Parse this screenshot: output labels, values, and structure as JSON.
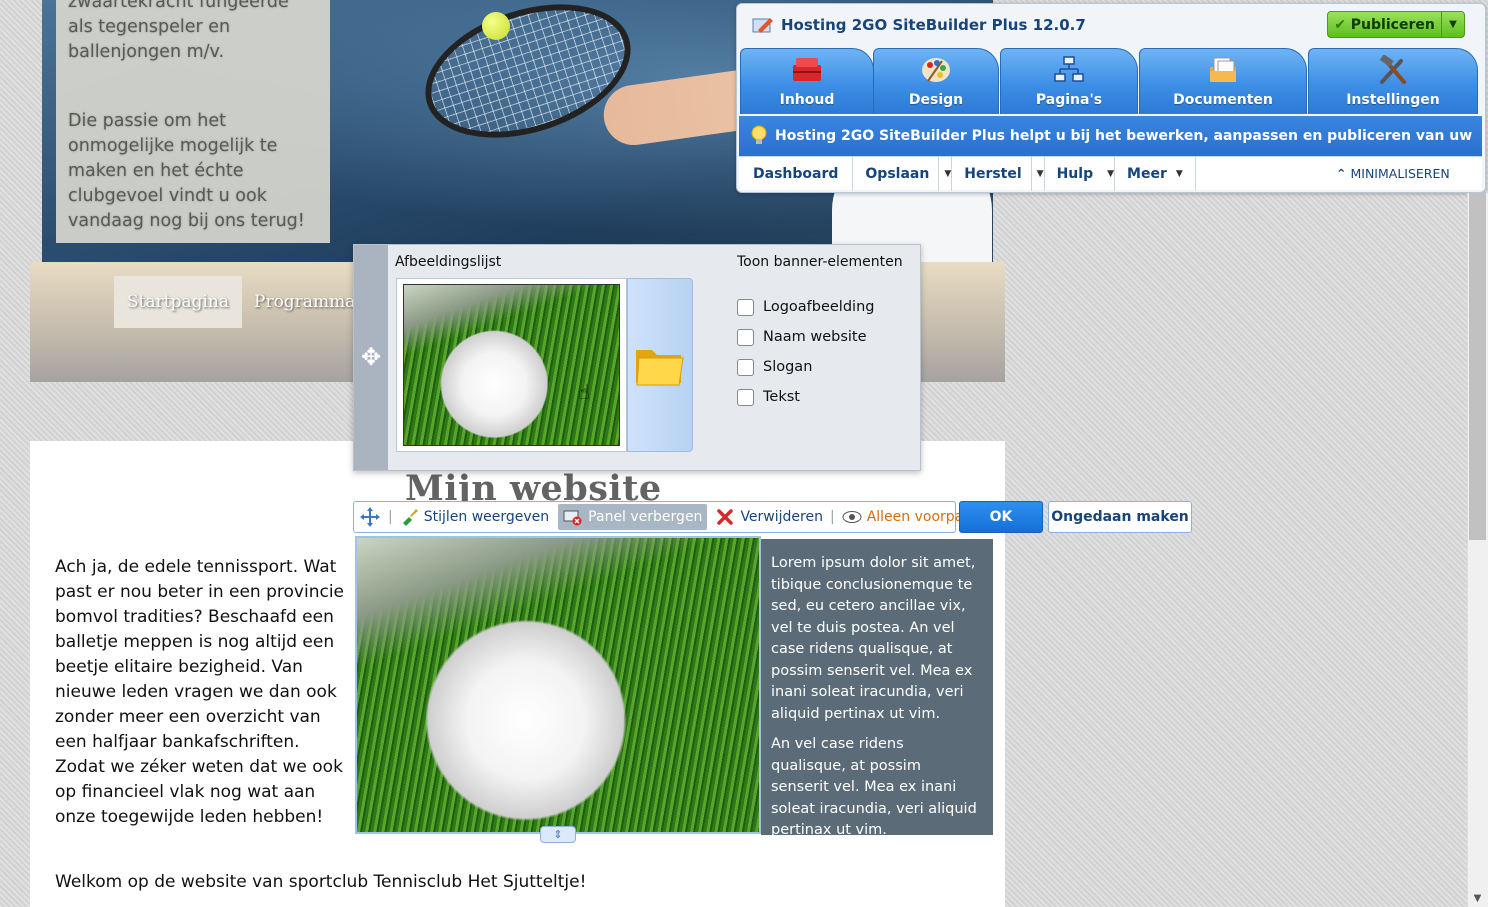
{
  "hero": {
    "text_p1": "zwaartekracht fungeerde als tegenspeler en ballenjongen m/v.",
    "text_p2": "Die passie om het onmogelijke mogelijk te maken en het échte clubgevoel vindt u ook vandaag nog bij ons terug!"
  },
  "nav": {
    "items": [
      {
        "label": "Startpagina",
        "active": true
      },
      {
        "label": "Programma",
        "active": false
      }
    ]
  },
  "site": {
    "title": "Mijn website",
    "intro": "Ach ja, de edele tennissport. Wat past er nou beter in een provincie bomvol tradities? Beschaafd een balletje meppen is nog altijd een beetje elitaire bezigheid. Van nieuwe leden vragen we dan ook zonder meer een overzicht van een halfjaar bankafschriften. Zodat we zéker weten dat we ook op financieel vlak nog wat aan onze toegewijde leden hebben!",
    "welcome": "Welkom op de website van sportclub Tennisclub Het Sjutteltje!",
    "text_box_p1": "Lorem ipsum dolor sit amet, tibique conclusionemque te sed, eu cetero ancillae vix, vel te duis postea. An vel case ridens qualisque, at possim senserit vel. Mea ex inani soleat iracundia, veri aliquid pertinax ut vim.",
    "text_box_p2": "An vel case ridens qualisque, at possim senserit vel. Mea ex inani soleat iracundia, veri aliquid pertinax ut vim."
  },
  "banner_panel": {
    "image_list_label": "Afbeeldingslijst",
    "elements_label": "Toon banner-elementen",
    "checkboxes": [
      {
        "label": "Logoafbeelding",
        "checked": false
      },
      {
        "label": "Naam website",
        "checked": false
      },
      {
        "label": "Slogan",
        "checked": false
      },
      {
        "label": "Tekst",
        "checked": false
      }
    ]
  },
  "toolbar": {
    "show_styles": "Stijlen weergeven",
    "hide_panel": "Panel verbergen",
    "delete": "Verwijderen",
    "scope": "Alleen voorpagina",
    "ok": "OK",
    "undo": "Ongedaan maken"
  },
  "sitebuilder": {
    "title": "Hosting 2GO SiteBuilder Plus 12.0.7",
    "publish": "Publiceren",
    "tabs": [
      {
        "label": "Inhoud",
        "icon": "toolbox-icon"
      },
      {
        "label": "Design",
        "icon": "palette-icon"
      },
      {
        "label": "Pagina's",
        "icon": "sitemap-icon"
      },
      {
        "label": "Documenten",
        "icon": "documents-icon"
      },
      {
        "label": "Instellingen",
        "icon": "tools-icon"
      }
    ],
    "info": "Hosting 2GO SiteBuilder Plus helpt u bij het bewerken, aanpassen en publiceren van uw website.",
    "menu": {
      "dashboard": "Dashboard",
      "save": "Opslaan",
      "restore": "Herstel",
      "help": "Hulp",
      "more": "Meer",
      "minimize": "MINIMALISEREN"
    }
  },
  "colors": {
    "accent_blue": "#2c7ad6",
    "publish_green": "#5cbf1e",
    "text_box_bg": "#5b6b78"
  }
}
